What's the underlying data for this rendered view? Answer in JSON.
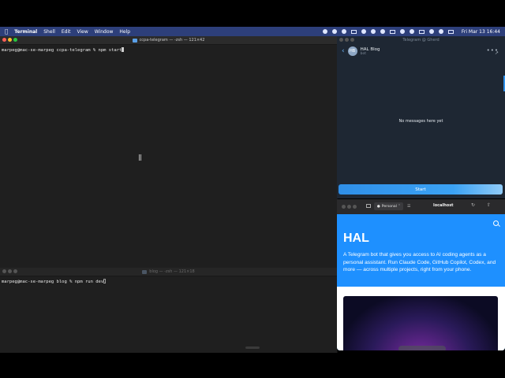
{
  "menubar": {
    "app_name": "Terminal",
    "menus": [
      "Shell",
      "Edit",
      "View",
      "Window",
      "Help"
    ],
    "clock": "Fri Mar 13  16:44"
  },
  "terminal_top": {
    "title": "ccpa-telegram — -zsh — 121×42",
    "prompt": "marpeg@mac-se-marpeg ccpa-telegram % npm start"
  },
  "terminal_bottom": {
    "title": "blog — -zsh — 121×18",
    "prompt": "marpeg@mac-se-marpeg blog % npm run dev"
  },
  "telegram": {
    "window_title": "Telegram @ Gherd",
    "chat_name": "HAL Blog",
    "chat_status": "bot",
    "avatar_initials": "HB",
    "empty_text": "No messages here yet",
    "start_label": "Start"
  },
  "browser": {
    "profile_label": "Personal",
    "url": "localhost",
    "site": {
      "title": "HAL",
      "description": "A Telegram bot that gives you access to AI coding agents as a personal assistant. Run Claude Code, GitHub Copilot, Codex, and more — across multiple projects, right from your phone."
    }
  }
}
